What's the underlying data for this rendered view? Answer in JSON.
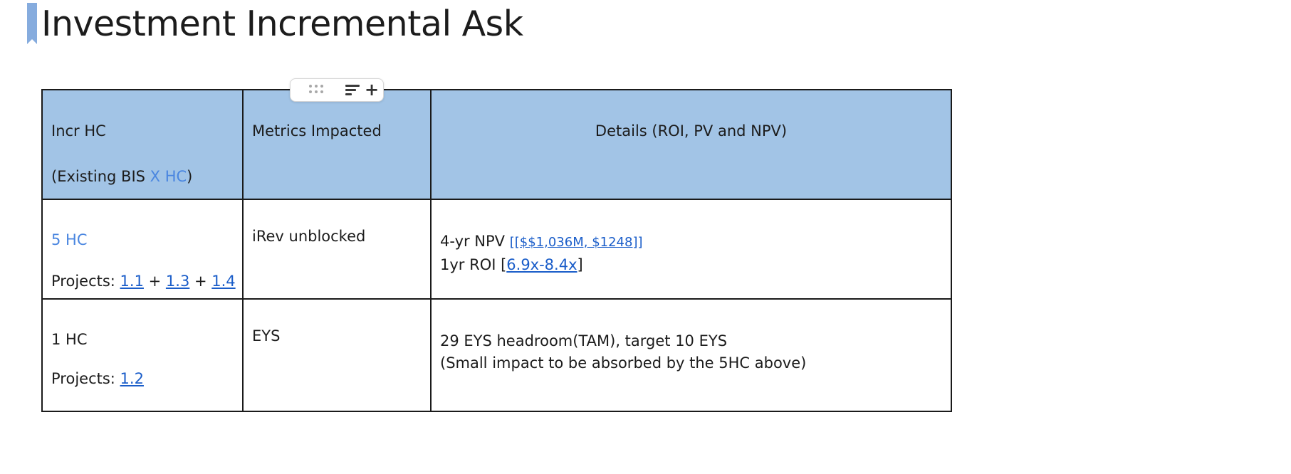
{
  "document": {
    "heading": "Investment Incremental Ask"
  },
  "toolbar": {
    "drag_icon": "drag-handle-icon",
    "align_icon": "align-left-icon",
    "add_icon": "plus-icon"
  },
  "table": {
    "header": {
      "col1_line1": "Incr HC",
      "col1_line2_prefix": "(Existing BIS ",
      "col1_line2_highlight": "X HC",
      "col1_line2_suffix": ")",
      "col2": "Metrics Impacted",
      "col3": "Details (ROI, PV and NPV)"
    },
    "rows": [
      {
        "hc": "5 HC",
        "projects_label": "Projects: ",
        "projects": [
          "1.1",
          "1.3",
          "1.4"
        ],
        "project_sep": " + ",
        "metric": "iRev unblocked",
        "detail_line1_prefix": "4-yr NPV ",
        "detail_line1_link": "[[$$1,036M, $1248]]",
        "detail_line2_prefix": "1yr ROI [",
        "detail_line2_link": "6.9x-8.4x",
        "detail_line2_suffix": "]"
      },
      {
        "hc": "1 HC",
        "projects_label": "Projects: ",
        "projects": [
          "1.2"
        ],
        "metric": "EYS",
        "detail_line1": "29 EYS headroom(TAM), target 10 EYS",
        "detail_line2": "(Small impact to be absorbed by the 5HC above)"
      }
    ]
  },
  "colors": {
    "header_fill": "#a2c4e6",
    "heading_marker": "#86acde",
    "highlight_text": "#4a86e0",
    "link": "#1a5dc9"
  }
}
